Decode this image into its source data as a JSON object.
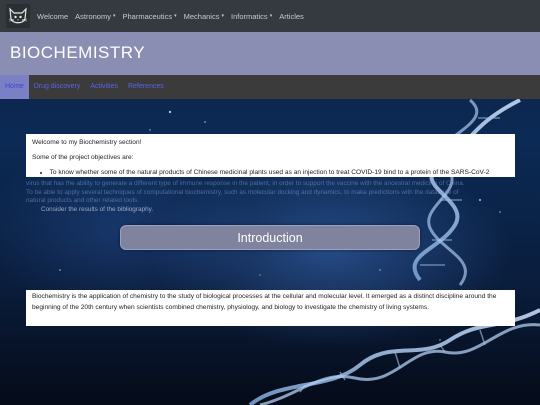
{
  "navbar": {
    "items": [
      {
        "label": "Welcome",
        "dropdown": false
      },
      {
        "label": "Astronomy",
        "dropdown": true
      },
      {
        "label": "Pharmaceutics",
        "dropdown": true
      },
      {
        "label": "Mechanics",
        "dropdown": true
      },
      {
        "label": "Informatics",
        "dropdown": true
      },
      {
        "label": "Articles",
        "dropdown": false
      }
    ],
    "caret": "▾",
    "logo_icon": "cat-face-icon"
  },
  "banner": {
    "title": "BIOCHEMISTRY"
  },
  "subnav": {
    "tabs": [
      {
        "label": "Home",
        "active": true
      },
      {
        "label": "Drug discovery",
        "active": false
      },
      {
        "label": "Activities",
        "active": false
      },
      {
        "label": "References",
        "active": false
      }
    ]
  },
  "objectives": {
    "welcome": "Welcome to my Biochemistry section!",
    "intro": "Some of the project objectives are:",
    "bullet_1": "To know whether some of the natural products of Chinese medicinal plants used as an injection to treat COVID-19 bind to a protein of the SARS-CoV-2",
    "overflow_line_1": "virus that has the ability to generate a different type of immune response in the patient, in order to support the vaccine with the ancestral medicine of China.",
    "overflow_line_2": "To be able to apply several techniques of computational biochemistry, such as molecular docking and dynamics, to make predictions with the database of",
    "overflow_line_3": "natural products and other related tools.",
    "overflow_line_4": "Consider the results of the bibliography."
  },
  "introduction": {
    "label": "Introduction"
  },
  "description": {
    "text": "Biochemistry is the application of chemistry to the study of biological processes at the cellular and molecular level. It emerged as a distinct discipline around the beginning of the 20th century when scientists combined chemistry, physiology, and biology to investigate the chemistry of living systems."
  },
  "colors": {
    "navbar": "#343a40",
    "banner": "#8a8eb3",
    "subnav": "#3b3b3b",
    "tab_link": "#5b62e8",
    "intro_pill": "#7f839e"
  }
}
